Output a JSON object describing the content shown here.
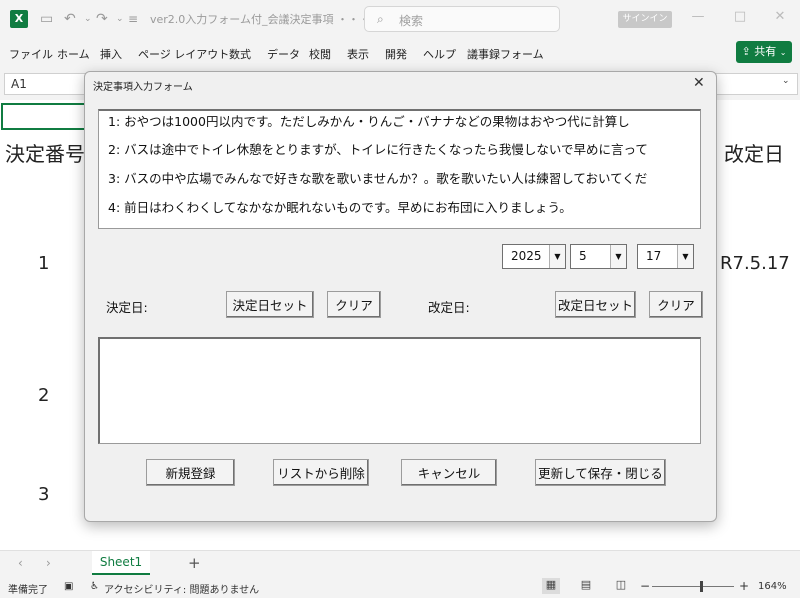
{
  "titlebar": {
    "title": "ver2.0入力フォーム付_会議決定事項 ・・・",
    "search_placeholder": "検索",
    "signin": "サインイン"
  },
  "ribbon": {
    "tabs": [
      "ファイル",
      "ホーム",
      "挿入",
      "ページ レイアウト",
      "数式",
      "データ",
      "校閲",
      "表示",
      "開発",
      "ヘルプ",
      "議事録フォーム"
    ],
    "share_label": "共有"
  },
  "formula": {
    "namebox": "A1"
  },
  "sheet": {
    "header_left": "決定番号",
    "header_right": "改定日",
    "row_numbers": [
      "1",
      "2",
      "3"
    ],
    "revise_value": "R7.5.17"
  },
  "dialog": {
    "title": "決定事項入力フォーム",
    "list_items": [
      "1: おやつは1000円以内です。ただしみかん・りんご・バナナなどの果物はおやつ代に計算し",
      "2: バスは途中でトイレ休憩をとりますが、トイレに行きたくなったら我慢しないで早めに言って",
      "3: バスの中や広場でみんなで好きな歌を歌いませんか？。歌を歌いたい人は練習しておいてくだ",
      "4: 前日はわくわくしてなかなか眠れないものです。早めにお布団に入りましょう。"
    ],
    "year": "2025",
    "month": "5",
    "day": "17",
    "decision_label": "決定日:",
    "decision_set": "決定日セット",
    "clear": "クリア",
    "revision_label": "改定日:",
    "revision_set": "改定日セット",
    "new_button": "新規登録",
    "delete_button": "リストから削除",
    "cancel_button": "キャンセル",
    "update_button": "更新して保存・閉じる"
  },
  "sheetbar": {
    "sheet_tab": "Sheet1"
  },
  "statusbar": {
    "ready": "準備完了",
    "accessibility": "アクセシビリティ: 問題ありません",
    "zoom": "164%"
  },
  "colors": {
    "excel_green": "#107c41",
    "dialog_bg": "#f0f0f0"
  }
}
